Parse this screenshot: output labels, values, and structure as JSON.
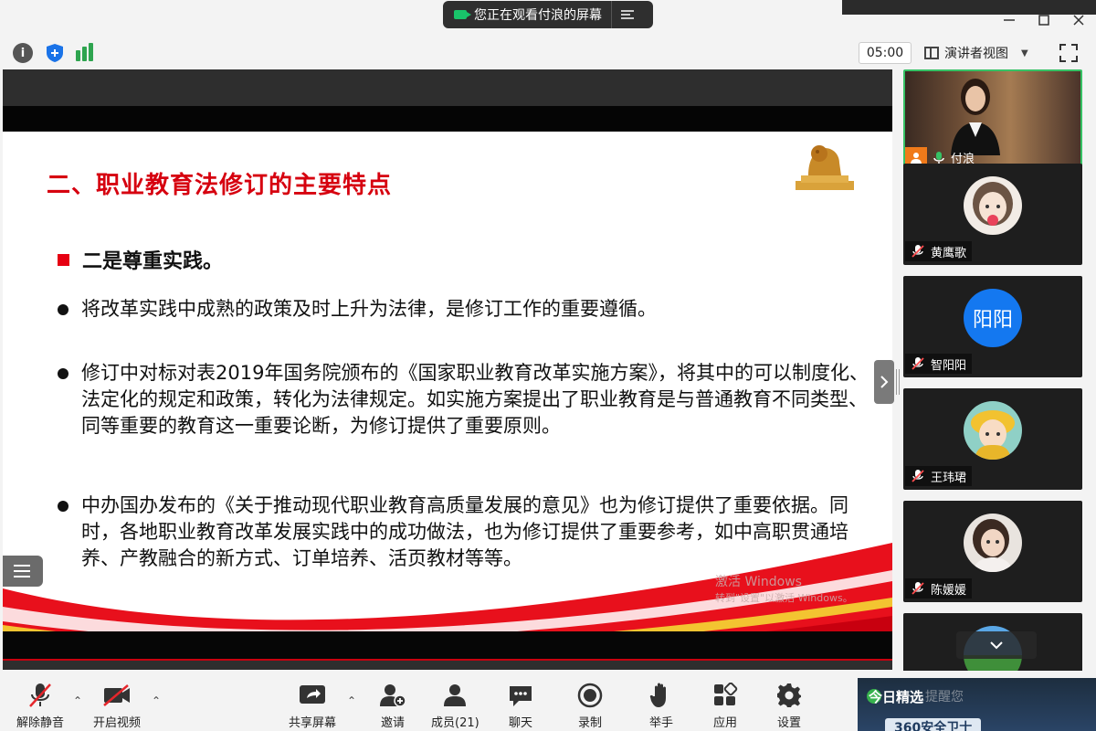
{
  "share_banner": {
    "text": "您正在观看付浪的屏幕"
  },
  "toolbar": {
    "timer": "05:00",
    "view_mode": "演讲者视图"
  },
  "slide": {
    "title": "二、职业教育法修订的主要特点",
    "subheading": "二是尊重实践。",
    "bullets": [
      "将改革实践中成熟的政策及时上升为法律，是修订工作的重要遵循。",
      "修订中对标对表2019年国务院颁布的《国家职业教育改革实施方案》，将其中的可以制度化、法定化的规定和政策，转化为法律规定。如实施方案提出了职业教育是与普通教育不同类型、同等重要的教育这一重要论断，为修订提供了重要原则。",
      "中办国办发布的《关于推动现代职业教育高质量发展的意见》也为修订提供了重要依据。同时，各地职业教育改革发展实践中的成功做法，也为修订提供了重要参考，如中高职贯通培养、产教融合的新方式、订单培养、活页教材等等。"
    ],
    "watermark_line1": "激活 Windows",
    "watermark_line2": "转到\"设置\"以激活 Windows。"
  },
  "participants": [
    {
      "name": "付浪",
      "type": "video",
      "host": true
    },
    {
      "name": "黄鹰歌",
      "type": "avatar",
      "muted": true
    },
    {
      "name": "智阳阳",
      "type": "text-avatar",
      "avatar_text": "阳阳",
      "muted": true
    },
    {
      "name": "王玮珺",
      "type": "avatar",
      "muted": true
    },
    {
      "name": "陈媛媛",
      "type": "avatar",
      "muted": true
    }
  ],
  "bottom_bar": {
    "unmute": "解除静音",
    "start_video": "开启视频",
    "share_screen": "共享屏幕",
    "invite": "邀请",
    "members": "成员(21)",
    "chat": "聊天",
    "record": "录制",
    "raise_hand": "举手",
    "apps": "应用",
    "settings": "设置"
  },
  "news": {
    "label": "今日精选",
    "ghost": "…提醒您",
    "sub": "360安全卫士"
  },
  "colors": {
    "accent_red": "#d6000f",
    "active_green": "#36c265",
    "avatar_blue": "#1478f0"
  }
}
